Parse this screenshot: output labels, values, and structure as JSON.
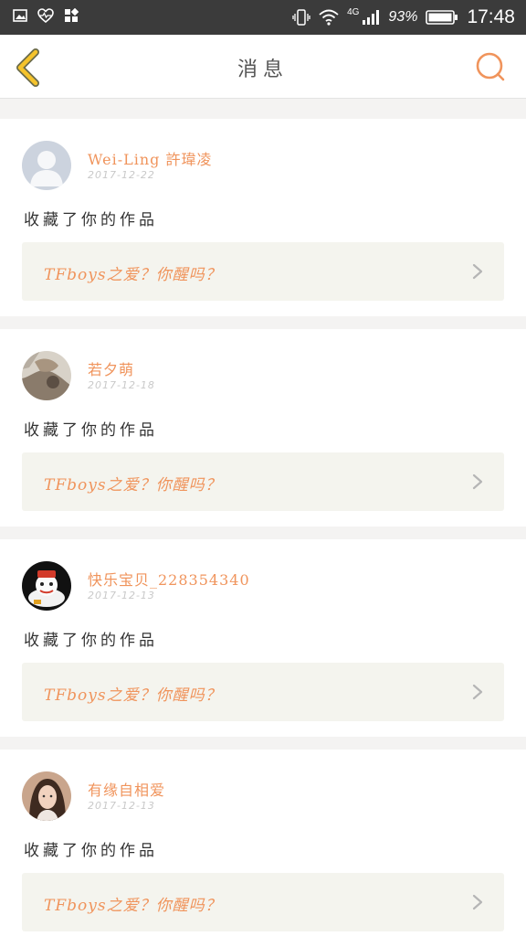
{
  "status_bar": {
    "network": "4G",
    "battery_text": "93%",
    "time": "17:48"
  },
  "header": {
    "title": "消息"
  },
  "messages": [
    {
      "user": "Wei-Ling 許瑋凌",
      "date": "2017-12-22",
      "action": "收藏了你的作品",
      "work": "TFboys之爱？你醒吗？",
      "avatar": "default-avatar"
    },
    {
      "user": "若夕萌",
      "date": "2017-12-18",
      "action": "收藏了你的作品",
      "work": "TFboys之爱？你醒吗？",
      "avatar": "photo-avatar"
    },
    {
      "user": "快乐宝贝_228354340",
      "date": "2017-12-13",
      "action": "收藏了你的作品",
      "work": "TFboys之爱？你醒吗？",
      "avatar": "cartoon-avatar"
    },
    {
      "user": "有缘自相爱",
      "date": "2017-12-13",
      "action": "收藏了你的作品",
      "work": "TFboys之爱？你醒吗？",
      "avatar": "girl-photo-avatar"
    }
  ],
  "colors": {
    "accent": "#f0945c",
    "back_arrow": "#f5c32c"
  }
}
